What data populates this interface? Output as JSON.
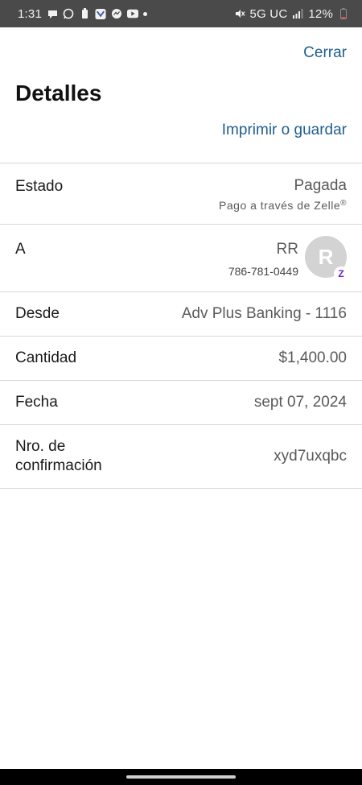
{
  "status_bar": {
    "time": "1:31",
    "network": "5G UC",
    "battery": "12%"
  },
  "header": {
    "close_label": "Cerrar",
    "title": "Detalles",
    "print_label": "Imprimir o guardar"
  },
  "details": {
    "status": {
      "label": "Estado",
      "value": "Pagada",
      "sub": "Pago a través de Zelle",
      "sub_mark": "®"
    },
    "to": {
      "label": "A",
      "name": "RR",
      "phone": "786-781-0449",
      "avatar_letter": "R",
      "badge": "Z"
    },
    "from": {
      "label": "Desde",
      "value": "Adv Plus Banking - 1116"
    },
    "amount": {
      "label": "Cantidad",
      "value": "$1,400.00"
    },
    "date": {
      "label": "Fecha",
      "value": "sept 07, 2024"
    },
    "confirmation": {
      "label_line1": "Nro. de",
      "label_line2": "confirmación",
      "value": "xyd7uxqbc"
    }
  },
  "colors": {
    "link": "#1f5e8e",
    "zelle": "#6d1ed4",
    "status_bar": "#4a4a4a"
  }
}
